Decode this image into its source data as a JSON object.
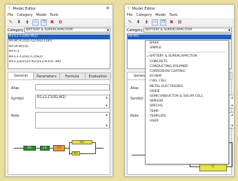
{
  "left_window": {
    "title": "Model Editor",
    "menu": [
      "File",
      "Category",
      "Model",
      "Tools"
    ],
    "category_label": "Category",
    "category_value": "BATTERY & SUPERCAPACITOR",
    "models": [
      "R1-L1-C1(R2-W2)",
      "Rs-Rc-R1(Q1-Q2)(R2-L(R))",
      "Rs-(R-W)(Q)",
      "Rs-C-L",
      "Rs-C1-C2(R1-C3(R2)",
      "Rs-C1(R1(Q1-R2))(L1-R3)(C-R4)"
    ],
    "selected_model_index": 0,
    "tabs": [
      "General",
      "Parameters",
      "Formula",
      "Evaluation"
    ],
    "active_tab_index": 0,
    "alias_label": "Alias",
    "symbol_label": "Symbol",
    "symbol_value": "R1-L1-C1(R2-W2)",
    "note_label": "Note",
    "circuit_labels": [
      "R1",
      "L1",
      "C1",
      "R2",
      "W2"
    ]
  },
  "right_window": {
    "title": "Model Editor",
    "menu": [
      "File",
      "Category",
      "Model",
      "Tools"
    ],
    "category_label": "Category",
    "category_value": "BATTERY & SUPERCAPACITOR",
    "model_visible": "Rs-R(C",
    "tab_visible": "General",
    "alias_label": "Alias",
    "symbol_label": "Symbol",
    "note_label": "Note",
    "dropdown_top": [
      "BASIC",
      "SIMPLE"
    ],
    "dropdown_items": [
      "BATTERY & SUPERCAPACITOR",
      "CONCRETE",
      "CONDUCTING POLYMER",
      "CORROSION COATING",
      "ECHEM",
      "FUEL CELL",
      "METAL ELECTRODES",
      "OXIDE",
      "SEMICONDUCTOR & SOLAR CELL",
      "SENSOR",
      "SPECIAL",
      "TEMP",
      "TEMPLATE",
      "USER"
    ],
    "checked_index": 0,
    "circuit_labels": [
      "Rs",
      "R",
      "C"
    ]
  },
  "colors": {
    "background": "#eadf9f",
    "selection": "#1d5fbf",
    "element_green": "#2f8a2f",
    "element_yellow": "#e6e44a",
    "element_orange": "#e69e3c"
  }
}
